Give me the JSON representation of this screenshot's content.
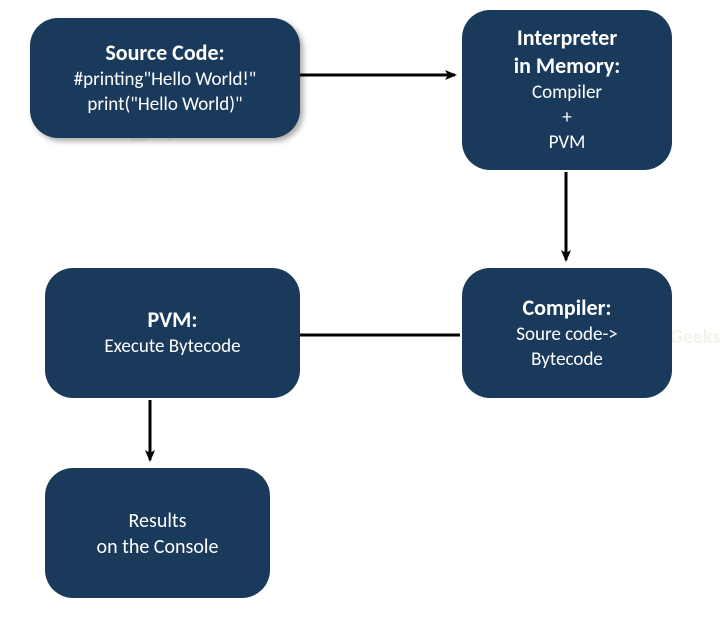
{
  "nodes": {
    "source": {
      "title": "Source Code:",
      "line1": "#printing\"Hello World!\"",
      "line2": "print(\"Hello World)\""
    },
    "interpreter": {
      "title_l1": "Interpreter",
      "title_l2": "in Memory:",
      "line1": "Compiler",
      "line2": "+",
      "line3": "PVM"
    },
    "compiler": {
      "title": "Compiler:",
      "line1": "Soure code->",
      "line2": "Bytecode"
    },
    "pvm": {
      "title": "PVM:",
      "line1": "Execute Bytecode"
    },
    "results": {
      "line1": "Results",
      "line2": "on the Console"
    }
  },
  "edges": [
    {
      "from": "source",
      "to": "interpreter",
      "arrow": true
    },
    {
      "from": "interpreter",
      "to": "compiler",
      "arrow": true
    },
    {
      "from": "compiler",
      "to": "pvm",
      "arrow": false
    },
    {
      "from": "pvm",
      "to": "results",
      "arrow": true
    }
  ],
  "watermark": "Python Geeks",
  "colors": {
    "box_fill": "#1a3a5c",
    "text": "#ffffff",
    "arrow": "#000000"
  }
}
